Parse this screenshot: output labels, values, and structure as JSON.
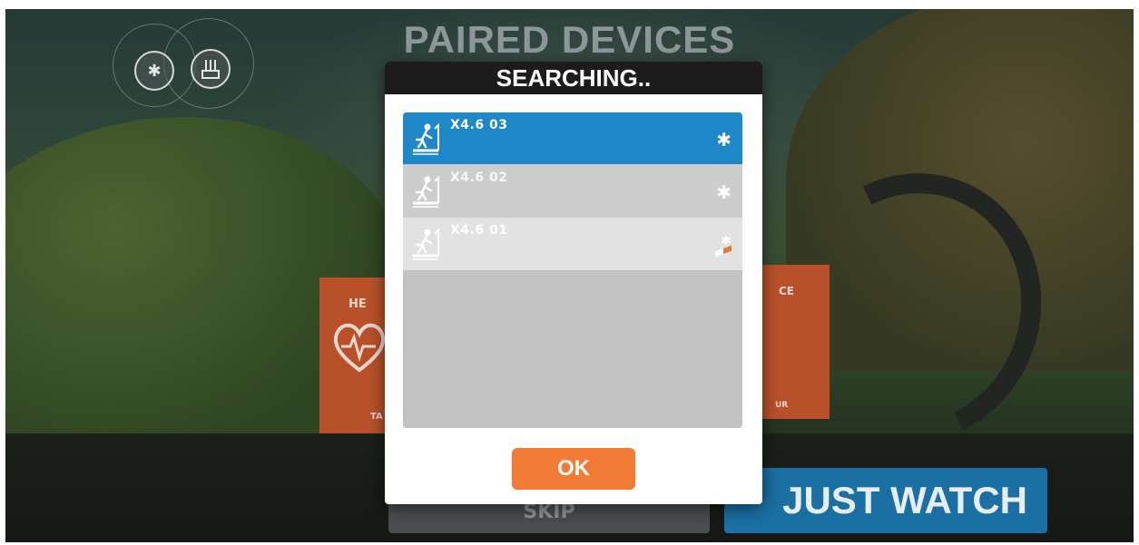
{
  "screen": {
    "title": "PAIRED DEVICES",
    "sensor_icons": [
      "bluetooth-icon",
      "ant-plus-icon"
    ]
  },
  "background_tiles": {
    "heart_rate": {
      "label": "HE",
      "sublabel": "TA"
    },
    "speed": {
      "label": "CE",
      "sublabel": "UR"
    }
  },
  "bottom": {
    "skip_label": "SKIP",
    "watch_label": "JUST WATCH"
  },
  "modal": {
    "header": "SEARCHING..",
    "devices": [
      {
        "name": "X4.6 03",
        "connection": "bluetooth",
        "selected": true
      },
      {
        "name": "X4.6 02",
        "connection": "bluetooth",
        "selected": false
      },
      {
        "name": "X4.6 01",
        "connection": "bluetooth",
        "selected": false
      }
    ],
    "ok_label": "OK"
  },
  "colors": {
    "selected_row": "#1d87c8",
    "ok_button": "#f27b35",
    "tile_orange": "#b8512a",
    "watch_button": "#1a6fa3"
  }
}
